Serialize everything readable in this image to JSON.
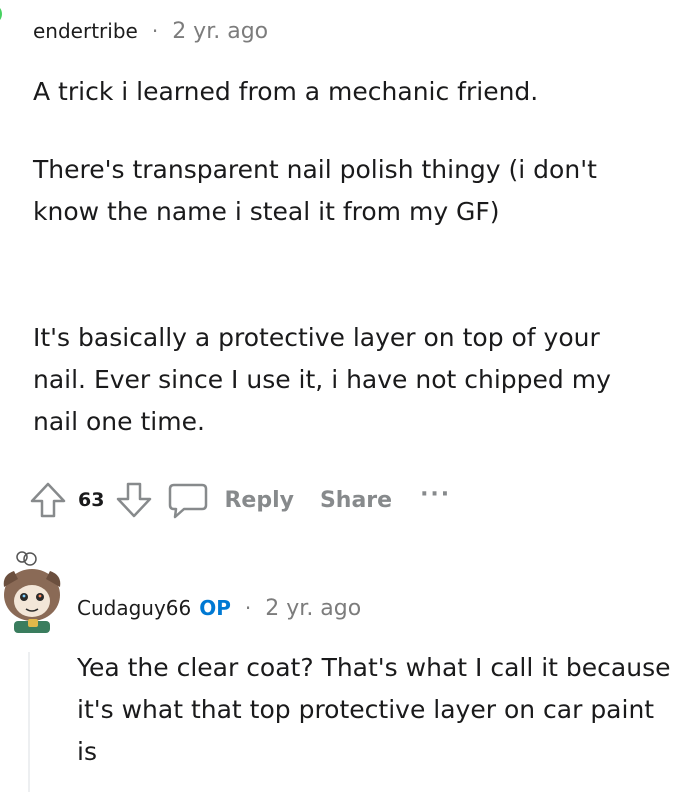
{
  "comments": [
    {
      "username": "endertribe",
      "separator": "·",
      "time": "2 yr. ago",
      "paragraphs": [
        "A trick i learned from a mechanic friend.",
        "There's transparent nail polish thingy (i don't know the name i steal it from my GF)",
        "It's basically a protective layer on top of your nail. Ever since I use it, i have not chipped my nail one time."
      ],
      "votes": "63",
      "actions": {
        "reply": "Reply",
        "share": "Share",
        "more": "···"
      },
      "icons": {
        "upvote": "upvote-arrow-icon",
        "downvote": "downvote-arrow-icon",
        "reply": "comment-bubble-icon",
        "avatar": "avatar"
      }
    },
    {
      "username": "Cudaguy66",
      "badge": "OP",
      "separator": "·",
      "time": "2 yr. ago",
      "paragraphs": [
        "Yea the clear coat? That's what I call it because it's what that top protective layer on car paint is"
      ],
      "icons": {
        "avatar": "avatar"
      }
    }
  ],
  "colors": {
    "text": "#1a1a1b",
    "muted": "#7c7c7c",
    "action": "#878a8c",
    "op_badge": "#0079d3",
    "thread_line": "#edeff1",
    "avatar_green": "#46d160"
  }
}
